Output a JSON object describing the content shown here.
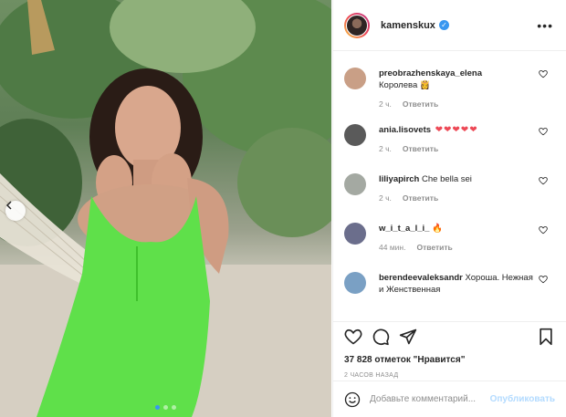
{
  "post": {
    "username": "kamenskux",
    "verified_icon": "verified-badge-icon",
    "more_icon": "more-options-icon"
  },
  "photo": {
    "description_icon": "post-photo",
    "carousel": {
      "dots": 3,
      "active_index": 0
    }
  },
  "comments": [
    {
      "user": "preobrazhenskaya_elena",
      "text": "Королева 👸",
      "time": "2 ч.",
      "reply": "Ответить",
      "avatar_color": "#c99f86"
    },
    {
      "user": "ania.lisovets",
      "text": "",
      "hearts": "❤❤❤❤❤",
      "time": "2 ч.",
      "reply": "Ответить",
      "avatar_color": "#5a5a5a"
    },
    {
      "user": "liliyapirch",
      "text": "Che bella sei",
      "time": "2 ч.",
      "reply": "Ответить",
      "avatar_color": "#a4a9a2"
    },
    {
      "user": "w_i_t_a_l_i_",
      "text": "🔥",
      "time": "44 мин.",
      "reply": "Ответить",
      "avatar_color": "#6b6e8c"
    },
    {
      "user": "berendeevaleksandr",
      "text": "Хороша. Нежная и Женственная",
      "time": "",
      "reply": "",
      "avatar_color": "#7aa0c4"
    }
  ],
  "actions": {
    "like_icon": "heart-icon",
    "comment_icon": "comment-icon",
    "share_icon": "share-icon",
    "save_icon": "bookmark-icon"
  },
  "likes_text": "37 828 отметок \"Нравится\"",
  "timestamp": "2 ЧАСОВ НАЗАД",
  "add_comment": {
    "placeholder": "Добавьте комментарий...",
    "publish_label": "Опубликовать"
  },
  "colors": {
    "link_blue": "#3897f0",
    "publish_disabled": "#b3dbff",
    "heart_red": "#ed4956",
    "dress_green": "#5fe04a"
  }
}
